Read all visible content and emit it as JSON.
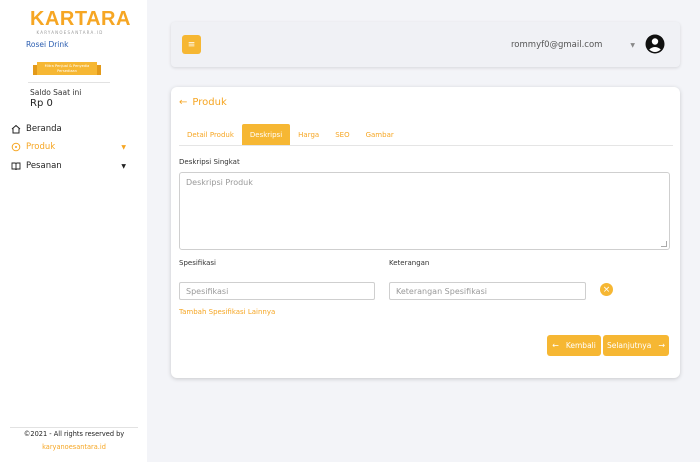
{
  "sidebar": {
    "logo": "KARTARA",
    "logo_sub": "KARYANOESANTARA.ID",
    "store_name": "Rosei Drink",
    "ribbon_text": "Mitra Penjual & Penyedia Persediaan",
    "saldo_label": "Saldo Saat ini",
    "saldo_value": "Rp 0",
    "nav": [
      {
        "label": "Beranda",
        "icon": "home-icon"
      },
      {
        "label": "Produk",
        "icon": "tag-icon",
        "active": true
      },
      {
        "label": "Pesanan",
        "icon": "book-icon"
      }
    ],
    "footer_copy": "©2021 - All rights reserved by",
    "footer_link": "karyanoesantara.id"
  },
  "topbar": {
    "menu_icon": "≡",
    "user_email": "rommyf0@gmail.com"
  },
  "card": {
    "back_label": "Produk",
    "tabs": [
      "Detail Produk",
      "Deskripsi",
      "Harga",
      "SEO",
      "Gambar"
    ],
    "active_tab": "Deskripsi",
    "short_desc_label": "Deskripsi Singkat",
    "short_desc_placeholder": "Deskripsi Produk",
    "spec_label": "Spesifikasi",
    "note_label": "Keterangan",
    "spec_placeholder": "Spesifikasi",
    "note_placeholder": "Keterangan Spesifikasi",
    "add_spec_link": "Tambah Spesifikasi Lainnya",
    "back_button": "Kembali",
    "next_button": "Selanjutnya"
  },
  "colors": {
    "accent": "#f6b733",
    "accent_text": "#f6a623",
    "link_blue": "#2a5db0"
  }
}
